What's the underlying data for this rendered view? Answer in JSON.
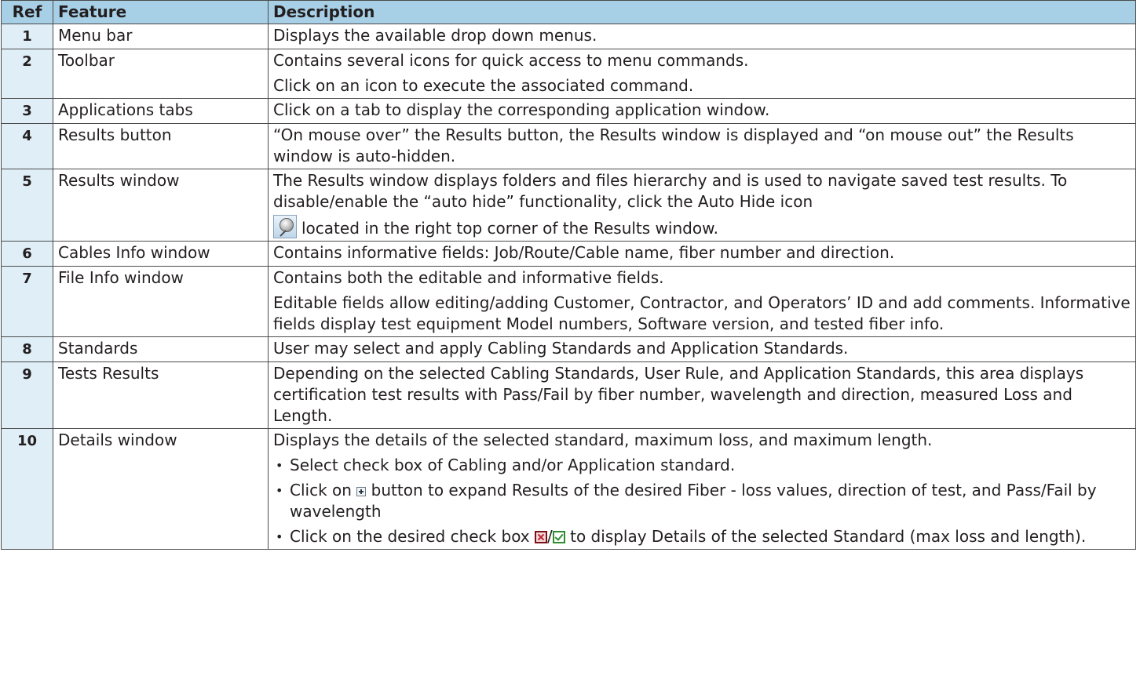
{
  "table": {
    "headers": {
      "ref": "Ref",
      "feature": "Feature",
      "description": "Description"
    },
    "rows": [
      {
        "ref": "1",
        "feature": "Menu bar",
        "desc": [
          "Displays the available drop down menus."
        ]
      },
      {
        "ref": "2",
        "feature": "Toolbar",
        "desc": [
          "Contains several icons for quick access to menu commands.",
          "Click on an icon to execute the associated command."
        ]
      },
      {
        "ref": "3",
        "feature": "Applications tabs",
        "desc": [
          "Click on a tab to display the corresponding application window."
        ]
      },
      {
        "ref": "4",
        "feature": "Results button",
        "desc": [
          "“On mouse over” the Results button, the Results window is displayed and “on mouse out” the Results window is auto-hidden."
        ]
      },
      {
        "ref": "5",
        "feature": "Results window",
        "desc_a": "The Results window displays folders and files hierarchy and is used to navigate saved test results. To disable/enable the “auto hide” functionality, click the Auto Hide icon",
        "desc_b": "located in the right top corner of the Results window."
      },
      {
        "ref": "6",
        "feature": "Cables Info window",
        "desc": [
          "Contains informative fields: Job/Route/Cable name, fiber number and direction."
        ]
      },
      {
        "ref": "7",
        "feature": "File Info window",
        "desc": [
          "Contains both the editable and informative fields.",
          "Editable fields allow editing/adding Customer, Contractor, and Operators’ ID and add comments. Informative fields display test equipment Model numbers, Software version, and tested fiber info."
        ]
      },
      {
        "ref": "8",
        "feature": "Standards",
        "desc": [
          "User may select and apply Cabling Standards and Application Standards."
        ]
      },
      {
        "ref": "9",
        "feature": "Tests Results",
        "desc": [
          "Depending on the selected Cabling Standards, User Rule, and Application Standards, this area displays certification test results with Pass/Fail by fiber number, wavelength and direction, measured Loss and Length."
        ]
      },
      {
        "ref": "10",
        "feature": "Details window",
        "intro": "Displays the details of the selected standard, maximum loss, and maximum length.",
        "bullet1": "Select check box of Cabling and/or Application standard.",
        "bullet2_pre": "Click on",
        "bullet2_post": "button to expand Results of the desired Fiber - loss values, direction of test, and Pass/Fail by wavelength",
        "bullet3_pre": "Click on the desired check box",
        "bullet3_sep": "/",
        "bullet3_post": "to display Details of the selected Standard (max loss and length)."
      }
    ]
  },
  "icons": {
    "auto_hide": "auto-hide-pin-icon",
    "expand": "expand-plus-icon",
    "checkbox_unchecked": "checkbox-x-icon",
    "checkbox_checked": "checkbox-check-icon"
  },
  "colors": {
    "header_bg": "#a7cfe6",
    "ref_col_bg": "#dfeef7",
    "border": "#4b4b4b"
  }
}
